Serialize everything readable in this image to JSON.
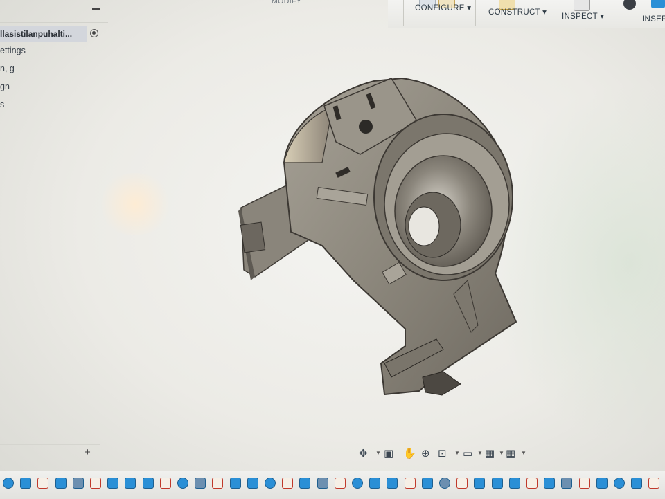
{
  "toolbar": {
    "modify_label": "MODIFY",
    "configure_label": "CONFIGURE ▾",
    "construct_label": "CONSTRUCT ▾",
    "inspect_label": "INSPECT ▾",
    "insert_label": "INSER"
  },
  "browser": {
    "document_name": "llasistilanpuhalti...",
    "items": [
      "ettings",
      "n, g",
      "gn",
      "s"
    ]
  },
  "comments": {
    "add_label": "+"
  },
  "navigation": {
    "icons": [
      "orbit-icon",
      "look-at-icon",
      "pan-icon",
      "zoom-icon",
      "fit-icon",
      "display-settings-icon",
      "grid-icon",
      "viewports-icon"
    ]
  },
  "timeline": {
    "feature_count": 38
  },
  "colors": {
    "accent_blue": "#2a8fd6",
    "part_gray": "#8f8a80"
  }
}
